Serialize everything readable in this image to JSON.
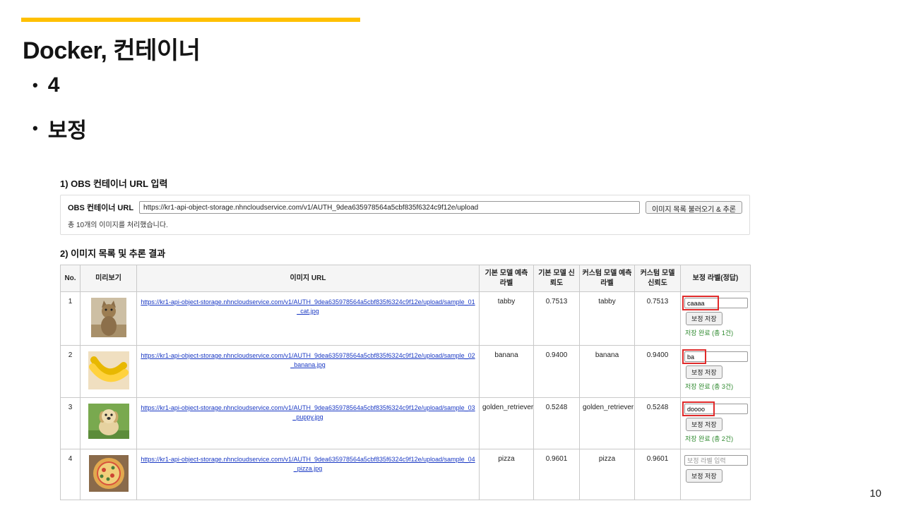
{
  "slide": {
    "title": "Docker, 컨테이너",
    "bullets": [
      "4",
      "보정"
    ],
    "page_number": "10",
    "accent_color": "#FFC000"
  },
  "app": {
    "section1_title": "1) OBS 컨테이너 URL 입력",
    "url_form": {
      "label": "OBS 컨테이너 URL",
      "input_value": "https://kr1-api-object-storage.nhncloudservice.com/v1/AUTH_9dea635978564a5cbf835f6324c9f12e/upload",
      "button_label": "이미지 목록 불러오기 & 추론",
      "status_text": "총 10개의 이미지를 처리했습니다."
    },
    "section2_title": "2) 이미지 목록 및 추론 결과",
    "table": {
      "headers": [
        "No.",
        "미리보기",
        "이미지 URL",
        "기본 모델 예측 라벨",
        "기본 모델 신뢰도",
        "커스텀 모델 예측 라벨",
        "커스텀 모델 신뢰도",
        "보정 라벨(정답)"
      ],
      "rows": [
        {
          "no": "1",
          "preview": "cat-photo",
          "url": "https://kr1-api-object-storage.nhncloudservice.com/v1/AUTH_9dea635978564a5cbf835f6324c9f12e/upload/sample_01_cat.jpg",
          "base_label": "tabby",
          "base_confidence": "0.7513",
          "custom_label": "tabby",
          "custom_confidence": "0.7513",
          "correction_value": "caaaa",
          "save_button": "보정 저장",
          "saved_text": "저장 완료 (총 1건)"
        },
        {
          "no": "2",
          "preview": "banana-photo",
          "url": "https://kr1-api-object-storage.nhncloudservice.com/v1/AUTH_9dea635978564a5cbf835f6324c9f12e/upload/sample_02_banana.jpg",
          "base_label": "banana",
          "base_confidence": "0.9400",
          "custom_label": "banana",
          "custom_confidence": "0.9400",
          "correction_value": "ba",
          "save_button": "보정 저장",
          "saved_text": "저장 완료 (총 3건)"
        },
        {
          "no": "3",
          "preview": "puppy-photo",
          "url": "https://kr1-api-object-storage.nhncloudservice.com/v1/AUTH_9dea635978564a5cbf835f6324c9f12e/upload/sample_03_puppy.jpg",
          "base_label": "golden_retriever",
          "base_confidence": "0.5248",
          "custom_label": "golden_retriever",
          "custom_confidence": "0.5248",
          "correction_value": "doooo",
          "save_button": "보정 저장",
          "saved_text": "저장 완료 (총 2건)"
        },
        {
          "no": "4",
          "preview": "pizza-photo",
          "url": "https://kr1-api-object-storage.nhncloudservice.com/v1/AUTH_9dea635978564a5cbf835f6324c9f12e/upload/sample_04_pizza.jpg",
          "base_label": "pizza",
          "base_confidence": "0.9601",
          "custom_label": "pizza",
          "custom_confidence": "0.9601",
          "correction_placeholder": "보정 라벨 입력",
          "save_button": "보정 저장"
        }
      ]
    }
  }
}
